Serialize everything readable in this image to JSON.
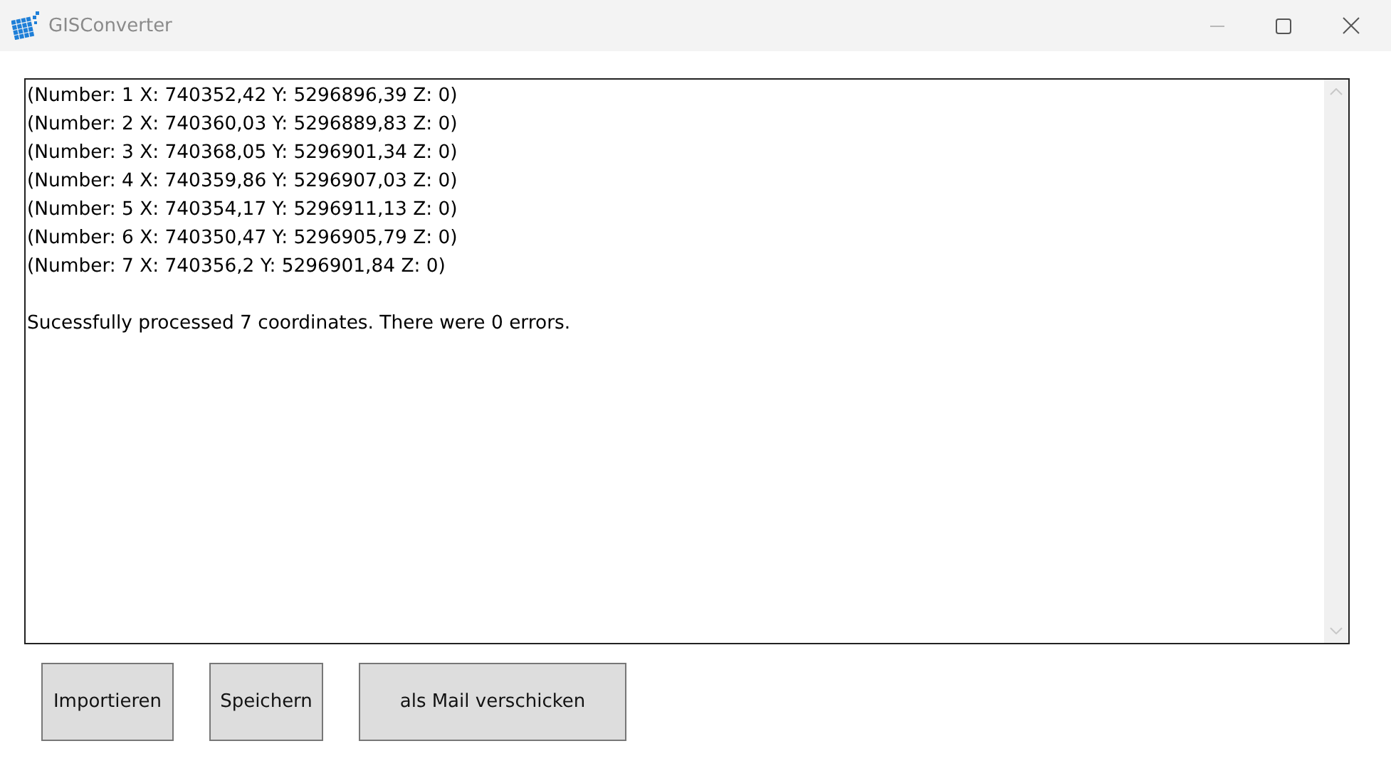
{
  "window": {
    "title": "GISConverter"
  },
  "output": {
    "lines": [
      "(Number: 1 X: 740352,42 Y: 5296896,39 Z: 0)",
      "(Number: 2 X: 740360,03 Y: 5296889,83 Z: 0)",
      "(Number: 3 X: 740368,05 Y: 5296901,34 Z: 0)",
      "(Number: 4 X: 740359,86 Y: 5296907,03 Z: 0)",
      "(Number: 5 X: 740354,17 Y: 5296911,13 Z: 0)",
      "(Number: 6 X: 740350,47 Y: 5296905,79 Z: 0)",
      "(Number: 7 X: 740356,2 Y: 5296901,84 Z: 0)"
    ],
    "summary": "Sucessfully processed 7 coordinates. There were 0 errors."
  },
  "buttons": [
    {
      "label": "Importieren"
    },
    {
      "label": "Speichern"
    },
    {
      "label": "als Mail verschicken"
    }
  ]
}
